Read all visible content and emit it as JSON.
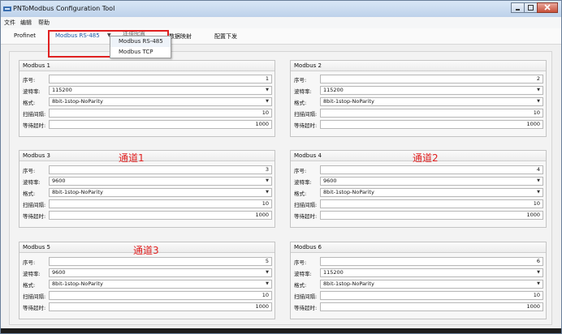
{
  "window": {
    "title": "PNToModbus Configuration Tool"
  },
  "menu": {
    "items": [
      "文件",
      "编辑",
      "帮助"
    ]
  },
  "toolbar": {
    "tabs": [
      {
        "label": "Profinet"
      },
      {
        "label": "Modbus RS-485"
      },
      {
        "label": "数据映射"
      },
      {
        "label": "配置下发"
      }
    ],
    "hidden_tab_partial": "连接配置"
  },
  "dropdown": {
    "items": [
      "Modbus RS-485",
      "Modbus TCP"
    ]
  },
  "labels": {
    "index": "序号:",
    "baud": "波特率:",
    "format": "格式:",
    "scan": "扫描间隔:",
    "timeout": "等待超时:"
  },
  "groups": [
    {
      "title": "Modbus 1",
      "index": "1",
      "baud": "115200",
      "format": "8bit-1stop-NoParity",
      "scan": "10",
      "timeout": "1000"
    },
    {
      "title": "Modbus 2",
      "index": "2",
      "baud": "115200",
      "format": "8bit-1stop-NoParity",
      "scan": "10",
      "timeout": "1000"
    },
    {
      "title": "Modbus 3",
      "index": "3",
      "baud": "9600",
      "format": "8bit-1stop-NoParity",
      "scan": "10",
      "timeout": "1000"
    },
    {
      "title": "Modbus 4",
      "index": "4",
      "baud": "9600",
      "format": "8bit-1stop-NoParity",
      "scan": "10",
      "timeout": "1000"
    },
    {
      "title": "Modbus 5",
      "index": "5",
      "baud": "9600",
      "format": "8bit-1stop-NoParity",
      "scan": "10",
      "timeout": "1000"
    },
    {
      "title": "Modbus 6",
      "index": "6",
      "baud": "115200",
      "format": "8bit-1stop-NoParity",
      "scan": "10",
      "timeout": "1000"
    }
  ],
  "annotations": [
    "通道1",
    "通道2",
    "通道3"
  ],
  "colors": {
    "annotation": "#e02020",
    "active_tab": "#1e5aa8"
  }
}
